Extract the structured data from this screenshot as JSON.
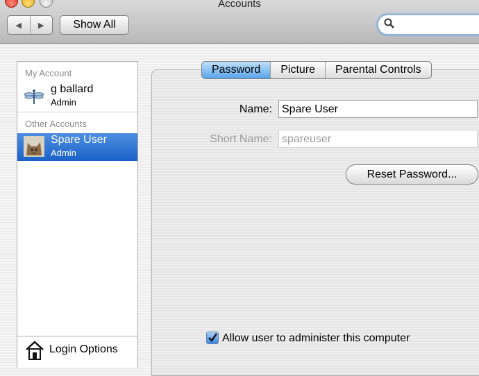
{
  "window": {
    "title": "Accounts"
  },
  "toolbar": {
    "back_icon": "◀",
    "forward_icon": "▶",
    "show_all_label": "Show All",
    "search": {
      "value": "",
      "placeholder": ""
    }
  },
  "sidebar": {
    "my_account_label": "My Account",
    "other_accounts_label": "Other Accounts",
    "my_account": {
      "name": "g ballard",
      "role": "Admin"
    },
    "other_accounts": [
      {
        "name": "Spare User",
        "role": "Admin",
        "selected": true
      }
    ],
    "login_options_label": "Login Options"
  },
  "tabs": [
    {
      "label": "Password",
      "active": true
    },
    {
      "label": "Picture",
      "active": false
    },
    {
      "label": "Parental Controls",
      "active": false
    }
  ],
  "form": {
    "name_label": "Name:",
    "name_value": "Spare User",
    "short_name_label": "Short Name:",
    "short_name_value": "spareuser",
    "reset_password_label": "Reset Password...",
    "admin_checkbox_label": "Allow user to administer this computer",
    "admin_checked": true
  },
  "colors": {
    "selection": "#2a6fd3",
    "tab_active": "#6fb0ee"
  }
}
